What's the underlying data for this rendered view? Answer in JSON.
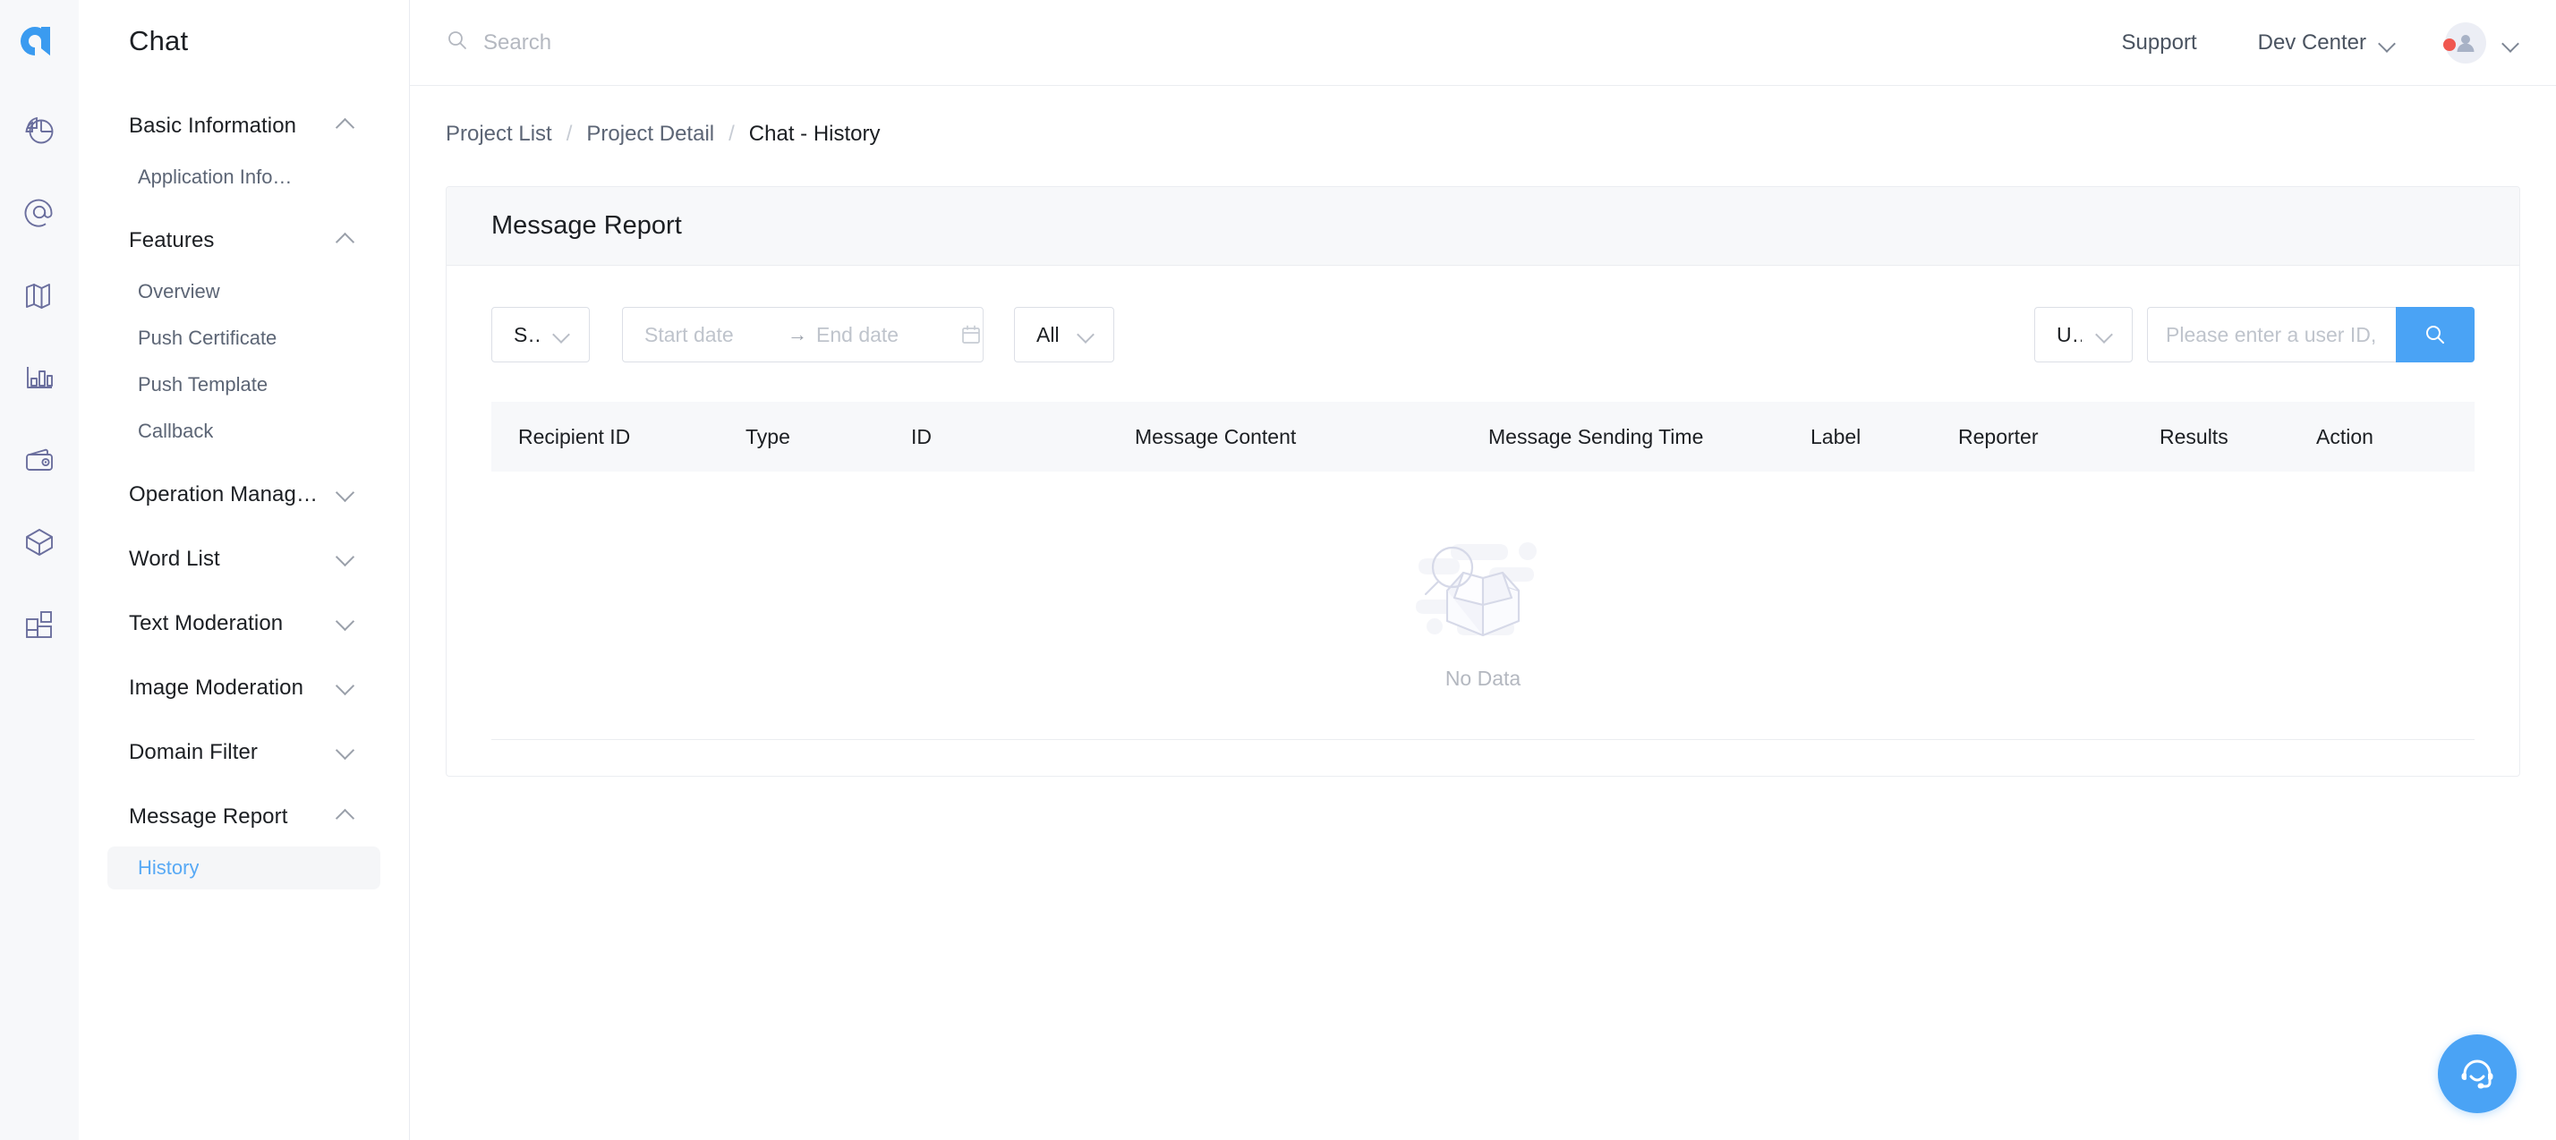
{
  "brand": {
    "logo_icon": "aurora-logo-icon"
  },
  "rail": {
    "items": [
      {
        "icon": "pie-chart-icon",
        "name": "analytics"
      },
      {
        "icon": "at-sign-icon",
        "name": "mentions"
      },
      {
        "icon": "map-icon",
        "name": "map"
      },
      {
        "icon": "bar-chart-icon",
        "name": "statistics"
      },
      {
        "icon": "wallet-icon",
        "name": "billing"
      },
      {
        "icon": "package-icon",
        "name": "products"
      },
      {
        "icon": "apps-grid-icon",
        "name": "apps"
      }
    ]
  },
  "sidebar": {
    "title": "Chat",
    "groups": [
      {
        "label": "Basic Information",
        "expanded": true,
        "chevron": "chevron-up-icon",
        "children": [
          {
            "label": "Application Info…",
            "active": false
          }
        ]
      },
      {
        "label": "Features",
        "expanded": true,
        "chevron": "chevron-up-icon",
        "children": [
          {
            "label": "Overview",
            "active": false
          },
          {
            "label": "Push Certificate",
            "active": false
          },
          {
            "label": "Push Template",
            "active": false
          },
          {
            "label": "Callback",
            "active": false
          }
        ]
      },
      {
        "label": "Operation Manag…",
        "expanded": false,
        "chevron": "chevron-down-icon",
        "children": []
      },
      {
        "label": "Word List",
        "expanded": false,
        "chevron": "chevron-down-icon",
        "children": []
      },
      {
        "label": "Text Moderation",
        "expanded": false,
        "chevron": "chevron-down-icon",
        "children": []
      },
      {
        "label": "Image Moderation",
        "expanded": false,
        "chevron": "chevron-down-icon",
        "children": []
      },
      {
        "label": "Domain Filter",
        "expanded": false,
        "chevron": "chevron-down-icon",
        "children": []
      },
      {
        "label": "Message Report",
        "expanded": true,
        "chevron": "chevron-up-icon",
        "children": [
          {
            "label": "History",
            "active": true
          }
        ]
      }
    ]
  },
  "header": {
    "search": {
      "value": "",
      "placeholder": "Search",
      "icon": "search-icon"
    },
    "support_label": "Support",
    "dev_center_label": "Dev Center",
    "dev_center_icon": "chevron-down-icon",
    "avatar_icon": "user-avatar-icon",
    "account_caret_icon": "chevron-down-icon",
    "has_notification": true
  },
  "breadcrumb": {
    "items": [
      {
        "label": "Project List",
        "current": false
      },
      {
        "label": "Project Detail",
        "current": false
      },
      {
        "label": "Chat - History",
        "current": true
      }
    ],
    "separator": "/"
  },
  "card": {
    "title": "Message Report"
  },
  "filters": {
    "scope_select": {
      "value": "Single ...",
      "icon": "chevron-down-icon"
    },
    "date_range": {
      "start_value": "",
      "start_placeholder": "Start date",
      "end_value": "",
      "end_placeholder": "End date",
      "arrow": "→",
      "icon": "calendar-icon"
    },
    "type_select": {
      "value": "All",
      "icon": "chevron-down-icon"
    },
    "id_type_select": {
      "value": "User ID",
      "icon": "chevron-down-icon"
    },
    "keyword": {
      "value": "",
      "placeholder": "Please enter a user ID, group ID, ..."
    },
    "search_button": {
      "icon": "search-icon",
      "color": "#4aa3f5"
    }
  },
  "table": {
    "columns": [
      "Recipient ID",
      "Type",
      "ID",
      "Message Content",
      "Message Sending Time",
      "Label",
      "Reporter",
      "Results",
      "Action"
    ],
    "rows": [],
    "empty": {
      "text": "No Data",
      "icon": "empty-box-search-icon"
    }
  },
  "fab": {
    "icon": "headset-support-icon",
    "color": "#4aa3f5"
  }
}
